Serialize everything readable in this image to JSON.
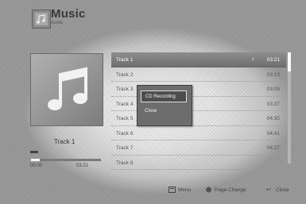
{
  "header": {
    "title": "Music",
    "subtitle": "Audio"
  },
  "now_playing": {
    "track_label": "Track 1",
    "time_current": "00:00",
    "time_total": "03:21",
    "progress": 0.0
  },
  "tracks": [
    {
      "name": "Track 1",
      "duration": "03:21",
      "selected": true,
      "playing_icon": "music-note-icon"
    },
    {
      "name": "Track 2",
      "duration": "03:13"
    },
    {
      "name": "Track 3",
      "duration": "03:09"
    },
    {
      "name": "Track 4",
      "duration": "03:37"
    },
    {
      "name": "Track 5",
      "duration": "04:35"
    },
    {
      "name": "Track 6",
      "duration": "04:41"
    },
    {
      "name": "Track 7",
      "duration": "04:27"
    },
    {
      "name": "Track 8",
      "duration": ""
    }
  ],
  "popup_menu": {
    "items": [
      "CD Recording",
      "Close"
    ],
    "highlighted_index": 0
  },
  "footer": {
    "menu_label": "Menu",
    "page_change_label": "Page Change",
    "close_label": "Close",
    "menu_icon": "menu-button-icon",
    "page_change_icon": "page-change-icon",
    "close_icon": "return-icon"
  }
}
